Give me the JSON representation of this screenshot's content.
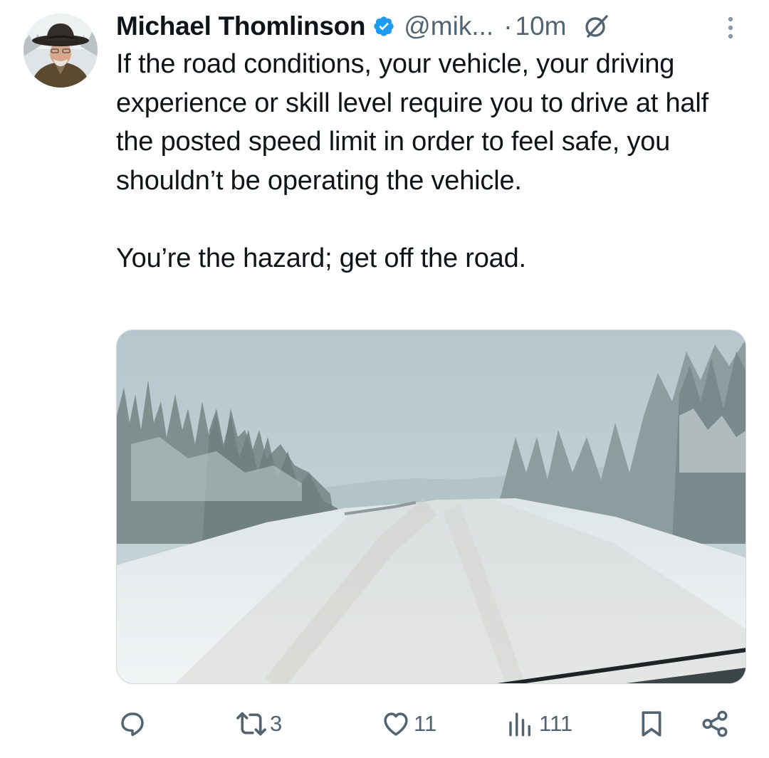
{
  "tweet": {
    "author": {
      "name": "Michael Thomlinson",
      "handle": "@mik...",
      "verified": true,
      "avatar": "avatar-cowboy-hat"
    },
    "separator": "·",
    "time": "10m",
    "header_icons": [
      "verified-badge-icon",
      "grok-icon",
      "more-vertical-icon"
    ],
    "text": {
      "paragraph1": "If the road conditions, your vehicle, your driving experience or skill level require you to drive at half the posted speed limit in order to feel safe, you shouldn’t be operating the vehicle.",
      "paragraph2": "You’re the hazard; get off the road."
    },
    "media": {
      "type": "photo",
      "subject": "snow-covered road through forest"
    },
    "actions": {
      "reply": {
        "icon": "reply-icon",
        "count": ""
      },
      "retweet": {
        "icon": "retweet-icon",
        "count": "3"
      },
      "like": {
        "icon": "heart-icon",
        "count": "11"
      },
      "views": {
        "icon": "views-icon",
        "count": "111"
      },
      "bookmark": {
        "icon": "bookmark-icon",
        "count": ""
      },
      "share": {
        "icon": "share-icon",
        "count": ""
      }
    }
  },
  "colors": {
    "text": "#0f1419",
    "secondary": "#536471",
    "verified": "#1d9bf0",
    "border": "#cfd9de"
  }
}
